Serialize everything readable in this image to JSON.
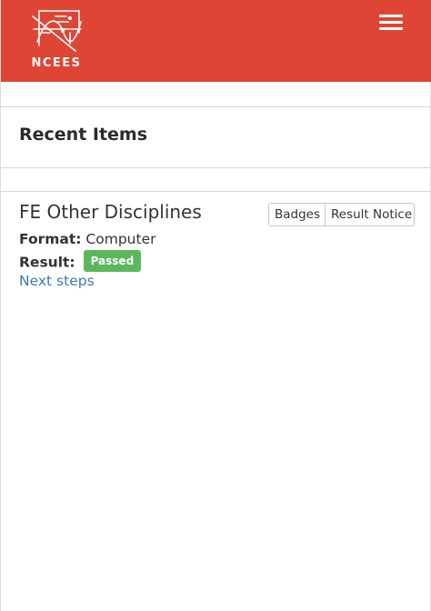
{
  "header": {
    "brand": "NCEES",
    "menu_icon": "hamburger-menu-icon",
    "background_color": "#de4535"
  },
  "recent": {
    "heading": "Recent Items"
  },
  "item": {
    "title": "FE Other Disciplines",
    "badges_button": "Badges",
    "result_notice_button": "Result Notice",
    "format_label": "Format:",
    "format_value": "Computer",
    "result_label": "Result:",
    "result_value": "Passed",
    "result_color": "#5cb85c",
    "next_steps_link": "Next steps",
    "link_color": "#3d7ab5"
  }
}
